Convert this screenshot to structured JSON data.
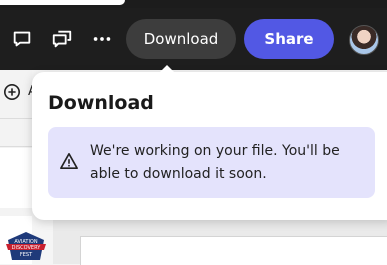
{
  "toolbar": {
    "download_label": "Download",
    "share_label": "Share",
    "icons": [
      "comment-icon",
      "comments-icon",
      "more-icon"
    ]
  },
  "left_panel": {
    "add_label": "A",
    "badge_text": "AVIATION DISCOVERY FEST"
  },
  "popover": {
    "title": "Download",
    "message": "We're working on your file. You'll be able to download it soon.",
    "icon": "warning-icon"
  },
  "colors": {
    "toolbar": "#1e1e1e",
    "share": "#5258e4",
    "download_button": "#3d3d3d",
    "notice": "#e4e3fc"
  }
}
